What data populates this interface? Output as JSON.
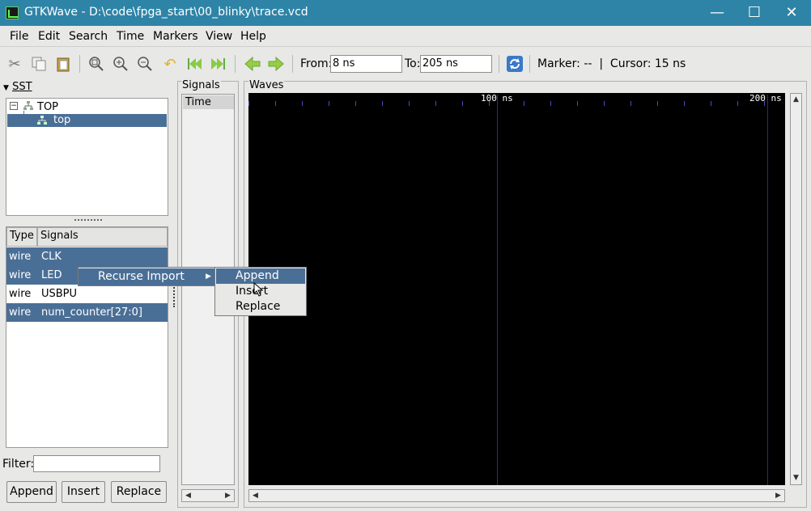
{
  "window": {
    "title": "GTKWave - D:\\code\\fpga_start\\00_blinky\\trace.vcd",
    "minimize": "—",
    "maximize": "☐",
    "close": "✕"
  },
  "menubar": [
    "File",
    "Edit",
    "Search",
    "Time",
    "Markers",
    "View",
    "Help"
  ],
  "toolbar": {
    "from_label": "From:",
    "from_value": "8 ns",
    "to_label": "To:",
    "to_value": "205 ns",
    "marker_text": "Marker: --  |  Cursor: 15 ns"
  },
  "sst": {
    "title": "SST",
    "tree": [
      {
        "label": "TOP"
      },
      {
        "label": "top"
      }
    ],
    "signals_header": {
      "type": "Type",
      "signals": "Signals"
    },
    "signals": [
      {
        "type": "wire",
        "name": "CLK"
      },
      {
        "type": "wire",
        "name": "LED"
      },
      {
        "type": "wire",
        "name": "USBPU"
      },
      {
        "type": "wire",
        "name": "num_counter[27:0]"
      }
    ],
    "filter_label": "Filter:",
    "filter_value": "",
    "buttons": {
      "append": "Append",
      "insert": "Insert",
      "replace": "Replace"
    }
  },
  "signals_pane": {
    "title": "Signals",
    "time_label": "Time"
  },
  "waves_pane": {
    "title": "Waves",
    "tick_100": "100 ns",
    "tick_200": "200 ns"
  },
  "context_menu": {
    "item": "Recurse Import"
  },
  "submenu": [
    "Append",
    "Insert",
    "Replace"
  ],
  "colors": {
    "titlebar": "#2e84a6",
    "selection": "#4a6f96",
    "wave_bg": "#000000",
    "grid": "#2a2a8a"
  }
}
